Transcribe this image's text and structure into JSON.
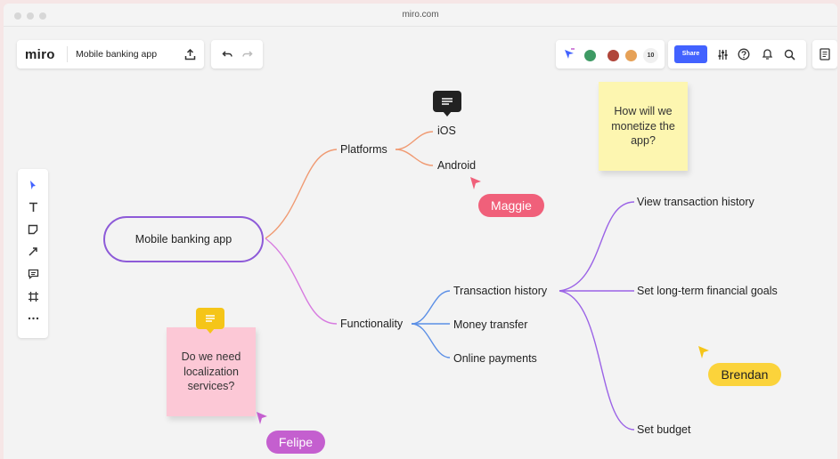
{
  "browser": {
    "url": "miro.com"
  },
  "toolbar": {
    "logo": "miro",
    "board_title": "Mobile banking app",
    "collaborator_count": "10",
    "share_label": "Share"
  },
  "mindmap": {
    "root": "Mobile banking app",
    "branches": {
      "platforms": {
        "label": "Platforms",
        "children": [
          "iOS",
          "Android"
        ]
      },
      "functionality": {
        "label": "Functionality",
        "children": [
          "Transaction history",
          "Money transfer",
          "Online payments"
        ]
      },
      "transaction_history_children": [
        "View transaction history",
        "Set long-term financial goals",
        "Set budget"
      ]
    }
  },
  "stickies": {
    "monetize": "How will we monetize the app?",
    "localization": "Do we need localization services?"
  },
  "cursors": {
    "maggie": "Maggie",
    "brendan": "Brendan",
    "felipe": "Felipe"
  },
  "colors": {
    "accent_blue": "#4262ff",
    "root_border": "#8d5ad8",
    "platforms_branch": "#f09a72",
    "functionality_branch": "#d77be0",
    "sub_branch_blue": "#5b8fe6",
    "sub_branch_purple": "#9b63e6",
    "maggie": "#f0607a",
    "brendan": "#fbd33b",
    "felipe": "#c45fcf",
    "sticky_yellow": "#fdf6b0",
    "sticky_pink": "#fcc8d6"
  },
  "icons": {
    "left_toolbar": [
      "cursor-icon",
      "text-icon",
      "sticky-note-icon",
      "arrow-line-icon",
      "comment-icon",
      "frame-icon",
      "more-icon"
    ]
  }
}
